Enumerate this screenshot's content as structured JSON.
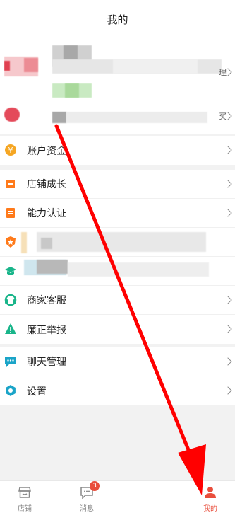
{
  "header": {
    "title": "我的"
  },
  "profile": {
    "row1_suffix": "理",
    "row2_suffix": "买"
  },
  "menu": {
    "account_funds": "账户资金",
    "store_growth": "店铺成长",
    "ability_cert": "能力认证",
    "merchant_service": "商家客服",
    "integrity_report": "廉正举报",
    "chat_manage": "聊天管理",
    "settings": "设置"
  },
  "tabbar": {
    "store": "店铺",
    "messages": "消息",
    "messages_badge": "3",
    "mine": "我的"
  },
  "colors": {
    "accent": "#e94e3c",
    "fund_icon": "#f5a623",
    "growth_icon": "#ff7a1a",
    "service_icon": "#19b58a",
    "report_icon": "#19b58a",
    "chat_icon": "#1aa4c8",
    "settings_icon": "#1aa4c8"
  }
}
